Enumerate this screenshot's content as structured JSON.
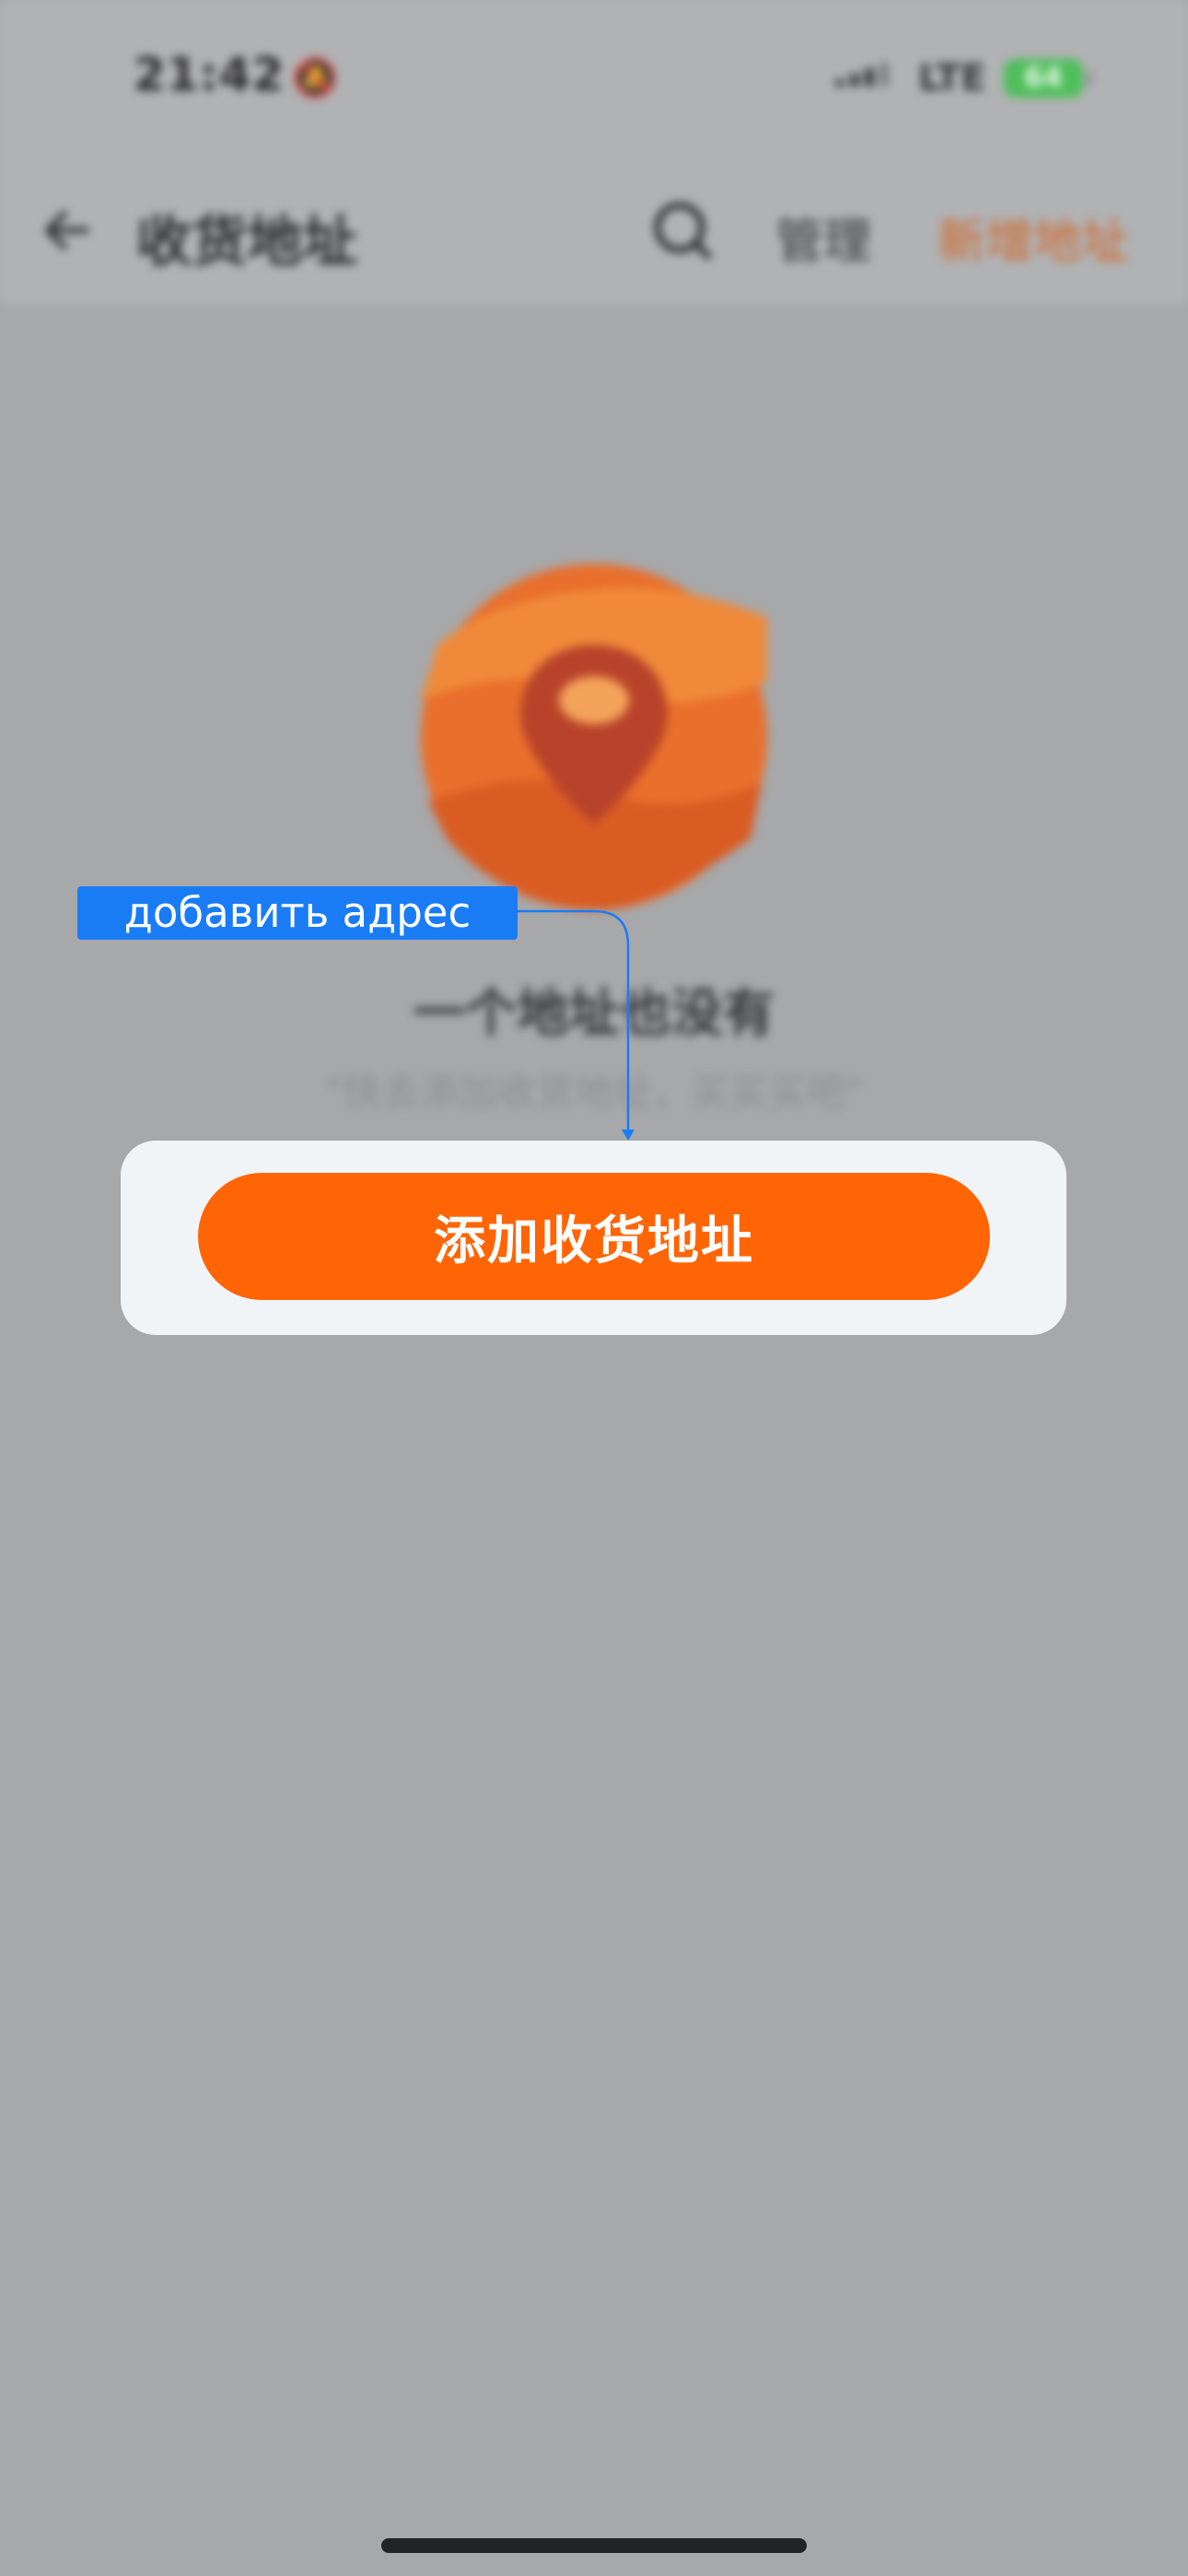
{
  "status_bar": {
    "time": "21:42",
    "network": "LTE",
    "battery": "64"
  },
  "nav": {
    "title": "收货地址",
    "manage_label": "管理",
    "add_label": "新增地址"
  },
  "empty_state": {
    "title": "一个地址也没有",
    "subtitle": "\"快去添加收货地址，买买买吧\""
  },
  "primary_action": {
    "label": "添加收货地址"
  },
  "annotation": {
    "label": "добавить адрес"
  },
  "colors": {
    "accent": "#ff6505",
    "annotation": "#1a7cf5",
    "overlay": "#a7a8aa",
    "card": "#f1f4f7"
  }
}
